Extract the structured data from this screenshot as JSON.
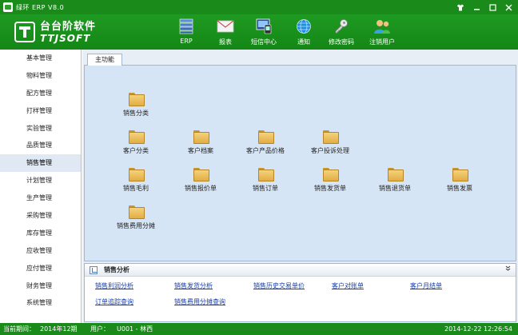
{
  "window": {
    "title": "绿环 ERP  V8.0"
  },
  "logo": {
    "cn": "台台阶软件",
    "en": "TTJSOFT"
  },
  "toolbar": [
    {
      "label": "ERP",
      "icon": "erp-icon"
    },
    {
      "label": "报表",
      "icon": "report-envelope-icon"
    },
    {
      "label": "短信中心",
      "icon": "sms-center-icon"
    },
    {
      "label": "通知",
      "icon": "notice-globe-icon"
    },
    {
      "label": "修改密码",
      "icon": "key-icon"
    },
    {
      "label": "注销用户",
      "icon": "users-icon"
    }
  ],
  "sidebar": {
    "items": [
      "基本管理",
      "物料管理",
      "配方管理",
      "打样管理",
      "实验管理",
      "品质管理",
      "销售管理",
      "计划管理",
      "生产管理",
      "采购管理",
      "库存管理",
      "应收管理",
      "应付管理",
      "财务管理",
      "系统管理"
    ],
    "active_index": 6
  },
  "tabs": {
    "main": "主功能"
  },
  "functions": {
    "sales_category": "销售分类",
    "row2": [
      "客户分类",
      "客户档案",
      "客户产品价格",
      "客户投诉处理"
    ],
    "row3": [
      "销售毛利",
      "销售报价单",
      "销售订单",
      "销售发货单",
      "销售退货单",
      "销售发票"
    ],
    "row4": [
      "销售费用分摊"
    ]
  },
  "analysis": {
    "title": "销售分析",
    "links": [
      "销售利润分析",
      "销售发货分析",
      "销售历史交易单价",
      "客户对账单",
      "客户月结单",
      "订单追踪查询",
      "销售费用分摊查询"
    ]
  },
  "status": {
    "period_label": "当前期间：",
    "period_value": "2014年12期",
    "user_label": "用户：",
    "user_value": "U001 - 林西",
    "datetime": "2014-12-22 12:26:54"
  }
}
